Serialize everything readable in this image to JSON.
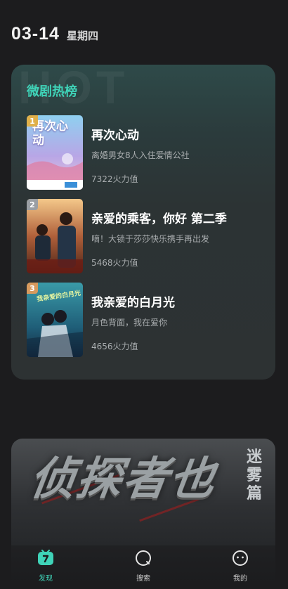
{
  "header": {
    "date": "03-14",
    "weekday": "星期四"
  },
  "hot_list": {
    "title": "微剧热榜",
    "watermark": "HOT",
    "items": [
      {
        "rank": "1",
        "title": "再次心动",
        "subtitle": "离婚男女8人入住爱情公社",
        "heat": "7322火力值",
        "poster_text": "再次心动",
        "rank_color": "#e0b04a"
      },
      {
        "rank": "2",
        "title": "亲爱的乘客，你好 第二季",
        "subtitle": "嘀！大锁于莎莎快乐携手再出发",
        "heat": "5468火力值",
        "rank_color": "#9a9ea3"
      },
      {
        "rank": "3",
        "title": "我亲爱的白月光",
        "subtitle": "月色背面，我在爱你",
        "heat": "4656火力值",
        "poster_text": "我亲爱的白月光",
        "rank_color": "#d79a5e"
      }
    ]
  },
  "banner": {
    "title": "侦探者也",
    "subtitle": "迷雾篇"
  },
  "tabbar": {
    "tabs": [
      {
        "label": "发现",
        "icon": "discover-tv-icon",
        "active": true
      },
      {
        "label": "搜索",
        "icon": "search-icon",
        "active": false
      },
      {
        "label": "我的",
        "icon": "profile-face-icon",
        "active": false
      }
    ]
  },
  "colors": {
    "accent": "#3fd3b8",
    "background": "#1c1c1e",
    "card": "#2d3233"
  }
}
